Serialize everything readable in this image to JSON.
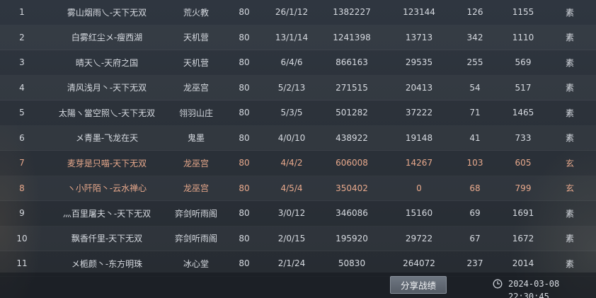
{
  "rows": [
    {
      "rank": "1",
      "name": "雾山烟雨乀-天下无双",
      "sect": "荒火教",
      "level": "80",
      "kda": "26/1/12",
      "damage": "1382227",
      "heal": "123144",
      "stat1": "126",
      "stat2": "1155",
      "type": "素",
      "highlight": false
    },
    {
      "rank": "2",
      "name": "白雾红尘メ-瘦西湖",
      "sect": "天机营",
      "level": "80",
      "kda": "13/1/14",
      "damage": "1241398",
      "heal": "13713",
      "stat1": "342",
      "stat2": "1110",
      "type": "素",
      "highlight": false
    },
    {
      "rank": "3",
      "name": "晴天乀-天府之国",
      "sect": "天机营",
      "level": "80",
      "kda": "6/4/6",
      "damage": "866163",
      "heal": "29535",
      "stat1": "255",
      "stat2": "569",
      "type": "素",
      "highlight": false
    },
    {
      "rank": "4",
      "name": "清风浅月丶-天下无双",
      "sect": "龙巫宫",
      "level": "80",
      "kda": "5/2/13",
      "damage": "271515",
      "heal": "20413",
      "stat1": "54",
      "stat2": "517",
      "type": "素",
      "highlight": false
    },
    {
      "rank": "5",
      "name": "太陽ヽ當空照乀-天下无双",
      "sect": "翎羽山庄",
      "level": "80",
      "kda": "5/3/5",
      "damage": "501282",
      "heal": "37222",
      "stat1": "71",
      "stat2": "1465",
      "type": "素",
      "highlight": false
    },
    {
      "rank": "6",
      "name": "メ青墨-飞龙在天",
      "sect": "鬼墨",
      "level": "80",
      "kda": "4/0/10",
      "damage": "438922",
      "heal": "19148",
      "stat1": "41",
      "stat2": "733",
      "type": "素",
      "highlight": false
    },
    {
      "rank": "7",
      "name": "麦芽是只喵-天下无双",
      "sect": "龙巫宫",
      "level": "80",
      "kda": "4/4/2",
      "damage": "606008",
      "heal": "14267",
      "stat1": "103",
      "stat2": "605",
      "type": "玄",
      "highlight": true
    },
    {
      "rank": "8",
      "name": "ヽ小阡陌丶-云水禅心",
      "sect": "龙巫宫",
      "level": "80",
      "kda": "4/5/4",
      "damage": "350402",
      "heal": "0",
      "stat1": "68",
      "stat2": "799",
      "type": "玄",
      "highlight": true
    },
    {
      "rank": "9",
      "name": "灬百里屠夫丶-天下无双",
      "sect": "弈剑听雨阁",
      "level": "80",
      "kda": "3/0/12",
      "damage": "346086",
      "heal": "15160",
      "stat1": "69",
      "stat2": "1691",
      "type": "素",
      "highlight": false
    },
    {
      "rank": "10",
      "name": "飘香仟里-天下无双",
      "sect": "弈剑听雨阁",
      "level": "80",
      "kda": "2/0/15",
      "damage": "195920",
      "heal": "29722",
      "stat1": "67",
      "stat2": "1672",
      "type": "素",
      "highlight": false
    },
    {
      "rank": "11",
      "name": "メ栀颜丶-东方明珠",
      "sect": "冰心堂",
      "level": "80",
      "kda": "2/1/24",
      "damage": "50830",
      "heal": "264072",
      "stat1": "237",
      "stat2": "2014",
      "type": "素",
      "highlight": false
    }
  ],
  "footer": {
    "share_label": "分享战绩",
    "timestamp": "2024-03-08 22:30:45",
    "icon": "clock-icon"
  },
  "colors": {
    "normal_text": "#d6dae0",
    "highlight_text": "#e8a98c"
  }
}
